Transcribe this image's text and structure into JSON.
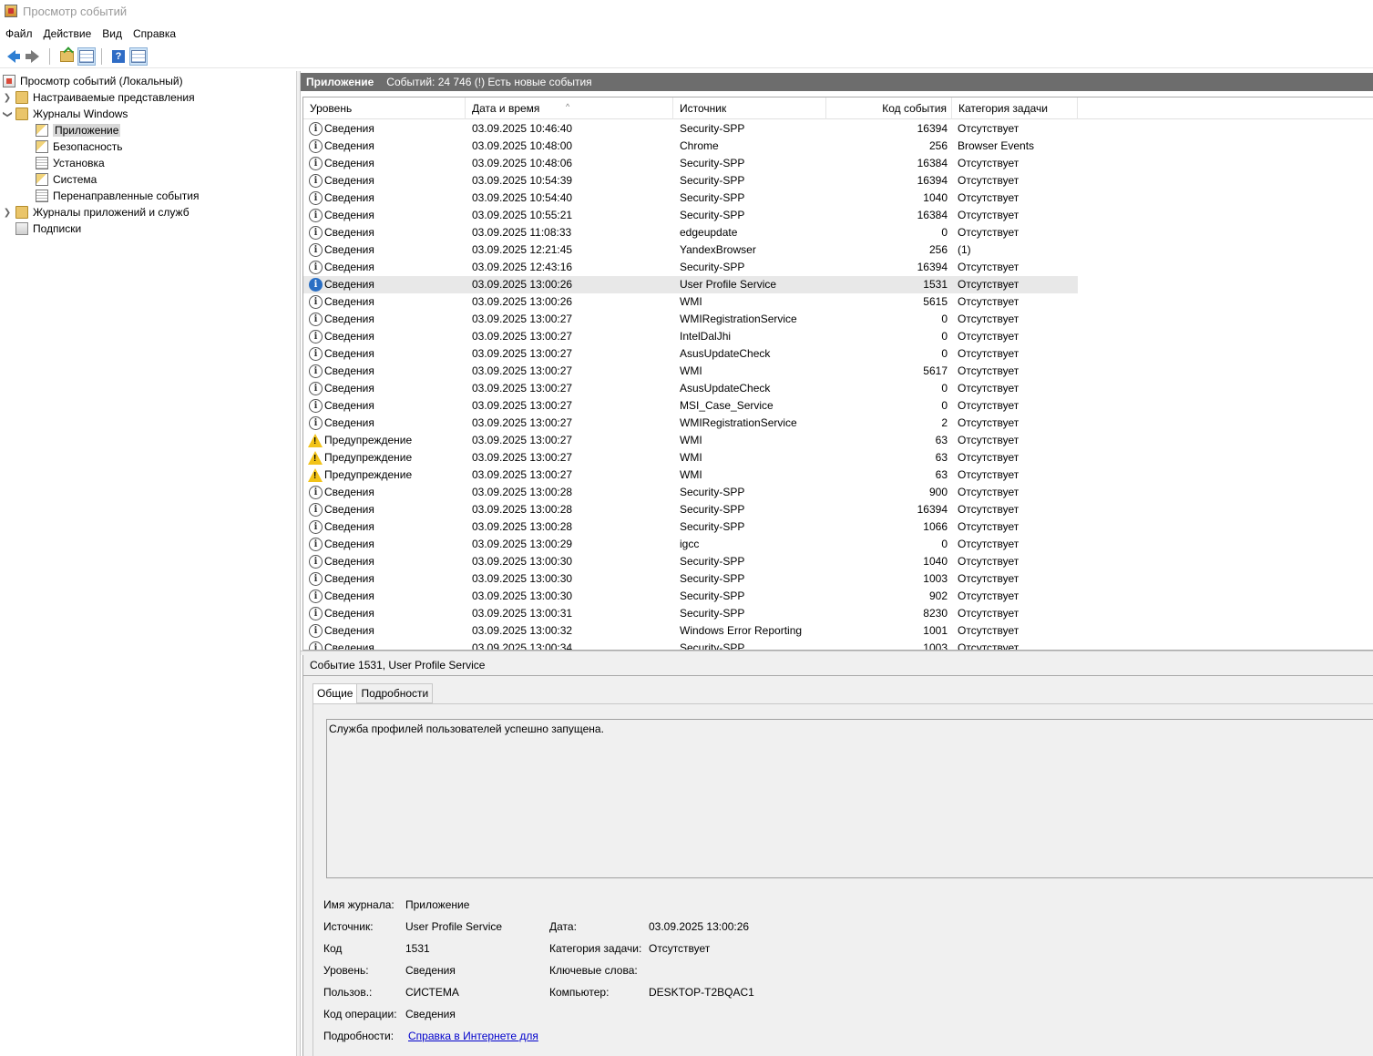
{
  "window": {
    "title": "Просмотр событий"
  },
  "menu": [
    "Файл",
    "Действие",
    "Вид",
    "Справка"
  ],
  "tree": {
    "root": "Просмотр событий (Локальный)",
    "custom_views": "Настраиваемые представления",
    "windows_logs": "Журналы Windows",
    "windows_logs_children": [
      "Приложение",
      "Безопасность",
      "Установка",
      "Система",
      "Перенаправленные события"
    ],
    "app_service_logs": "Журналы приложений и служб",
    "subscriptions": "Подписки"
  },
  "header": {
    "title": "Приложение",
    "info": "Событий: 24 746 (!) Есть новые события"
  },
  "columns": [
    "Уровень",
    "Дата и время",
    "Источник",
    "Код события",
    "Категория задачи"
  ],
  "events": [
    {
      "level": "Сведения",
      "type": "info",
      "datetime": "03.09.2025 10:46:40",
      "source": "Security-SPP",
      "code": "16394",
      "category": "Отсутствует"
    },
    {
      "level": "Сведения",
      "type": "info",
      "datetime": "03.09.2025 10:48:00",
      "source": "Chrome",
      "code": "256",
      "category": "Browser Events"
    },
    {
      "level": "Сведения",
      "type": "info",
      "datetime": "03.09.2025 10:48:06",
      "source": "Security-SPP",
      "code": "16384",
      "category": "Отсутствует"
    },
    {
      "level": "Сведения",
      "type": "info",
      "datetime": "03.09.2025 10:54:39",
      "source": "Security-SPP",
      "code": "16394",
      "category": "Отсутствует"
    },
    {
      "level": "Сведения",
      "type": "info",
      "datetime": "03.09.2025 10:54:40",
      "source": "Security-SPP",
      "code": "1040",
      "category": "Отсутствует"
    },
    {
      "level": "Сведения",
      "type": "info",
      "datetime": "03.09.2025 10:55:21",
      "source": "Security-SPP",
      "code": "16384",
      "category": "Отсутствует"
    },
    {
      "level": "Сведения",
      "type": "info",
      "datetime": "03.09.2025 11:08:33",
      "source": "edgeupdate",
      "code": "0",
      "category": "Отсутствует"
    },
    {
      "level": "Сведения",
      "type": "info",
      "datetime": "03.09.2025 12:21:45",
      "source": "YandexBrowser",
      "code": "256",
      "category": "(1)"
    },
    {
      "level": "Сведения",
      "type": "info",
      "datetime": "03.09.2025 12:43:16",
      "source": "Security-SPP",
      "code": "16394",
      "category": "Отсутствует"
    },
    {
      "level": "Сведения",
      "type": "info",
      "selected": true,
      "datetime": "03.09.2025 13:00:26",
      "source": "User Profile Service",
      "code": "1531",
      "category": "Отсутствует"
    },
    {
      "level": "Сведения",
      "type": "info",
      "datetime": "03.09.2025 13:00:26",
      "source": "WMI",
      "code": "5615",
      "category": "Отсутствует"
    },
    {
      "level": "Сведения",
      "type": "info",
      "datetime": "03.09.2025 13:00:27",
      "source": "WMIRegistrationService",
      "code": "0",
      "category": "Отсутствует"
    },
    {
      "level": "Сведения",
      "type": "info",
      "datetime": "03.09.2025 13:00:27",
      "source": "IntelDalJhi",
      "code": "0",
      "category": "Отсутствует"
    },
    {
      "level": "Сведения",
      "type": "info",
      "datetime": "03.09.2025 13:00:27",
      "source": "AsusUpdateCheck",
      "code": "0",
      "category": "Отсутствует"
    },
    {
      "level": "Сведения",
      "type": "info",
      "datetime": "03.09.2025 13:00:27",
      "source": "WMI",
      "code": "5617",
      "category": "Отсутствует"
    },
    {
      "level": "Сведения",
      "type": "info",
      "datetime": "03.09.2025 13:00:27",
      "source": "AsusUpdateCheck",
      "code": "0",
      "category": "Отсутствует"
    },
    {
      "level": "Сведения",
      "type": "info",
      "datetime": "03.09.2025 13:00:27",
      "source": "MSI_Case_Service",
      "code": "0",
      "category": "Отсутствует"
    },
    {
      "level": "Сведения",
      "type": "info",
      "datetime": "03.09.2025 13:00:27",
      "source": "WMIRegistrationService",
      "code": "2",
      "category": "Отсутствует"
    },
    {
      "level": "Предупреждение",
      "type": "warning",
      "datetime": "03.09.2025 13:00:27",
      "source": "WMI",
      "code": "63",
      "category": "Отсутствует"
    },
    {
      "level": "Предупреждение",
      "type": "warning",
      "datetime": "03.09.2025 13:00:27",
      "source": "WMI",
      "code": "63",
      "category": "Отсутствует"
    },
    {
      "level": "Предупреждение",
      "type": "warning",
      "datetime": "03.09.2025 13:00:27",
      "source": "WMI",
      "code": "63",
      "category": "Отсутствует"
    },
    {
      "level": "Сведения",
      "type": "info",
      "datetime": "03.09.2025 13:00:28",
      "source": "Security-SPP",
      "code": "900",
      "category": "Отсутствует"
    },
    {
      "level": "Сведения",
      "type": "info",
      "datetime": "03.09.2025 13:00:28",
      "source": "Security-SPP",
      "code": "16394",
      "category": "Отсутствует"
    },
    {
      "level": "Сведения",
      "type": "info",
      "datetime": "03.09.2025 13:00:28",
      "source": "Security-SPP",
      "code": "1066",
      "category": "Отсутствует"
    },
    {
      "level": "Сведения",
      "type": "info",
      "datetime": "03.09.2025 13:00:29",
      "source": "igcc",
      "code": "0",
      "category": "Отсутствует"
    },
    {
      "level": "Сведения",
      "type": "info",
      "datetime": "03.09.2025 13:00:30",
      "source": "Security-SPP",
      "code": "1040",
      "category": "Отсутствует"
    },
    {
      "level": "Сведения",
      "type": "info",
      "datetime": "03.09.2025 13:00:30",
      "source": "Security-SPP",
      "code": "1003",
      "category": "Отсутствует"
    },
    {
      "level": "Сведения",
      "type": "info",
      "datetime": "03.09.2025 13:00:30",
      "source": "Security-SPP",
      "code": "902",
      "category": "Отсутствует"
    },
    {
      "level": "Сведения",
      "type": "info",
      "datetime": "03.09.2025 13:00:31",
      "source": "Security-SPP",
      "code": "8230",
      "category": "Отсутствует"
    },
    {
      "level": "Сведения",
      "type": "info",
      "datetime": "03.09.2025 13:00:32",
      "source": "Windows Error Reporting",
      "code": "1001",
      "category": "Отсутствует"
    },
    {
      "level": "Сведения",
      "type": "info",
      "datetime": "03.09.2025 13:00:34",
      "source": "Security-SPP",
      "code": "1003",
      "category": "Отсутствует"
    }
  ],
  "detail": {
    "title": "Событие 1531, User Profile Service",
    "tabs": [
      "Общие",
      "Подробности"
    ],
    "message": "Служба профилей пользователей успешно запущена.",
    "labels": {
      "log_name": "Имя журнала:",
      "source": "Источник:",
      "code": "Код",
      "level": "Уровень:",
      "user": "Пользов.:",
      "opcode": "Код операции:",
      "more": "Подробности:",
      "date": "Дата:",
      "task_category": "Категория задачи:",
      "keywords": "Ключевые слова:",
      "computer": "Компьютер:"
    },
    "values": {
      "log_name": "Приложение",
      "source": "User Profile Service",
      "code": "1531",
      "level": "Сведения",
      "user": "СИСТЕМА",
      "opcode": "Сведения",
      "more_link": "Справка в Интернете для",
      "date": "03.09.2025 13:00:26",
      "task_category": "Отсутствует",
      "keywords": "",
      "computer": "DESKTOP-T2BQAC1"
    }
  },
  "icons": {
    "back": "arrow-left-icon",
    "forward": "arrow-right-icon",
    "folder_up": "folder-up-icon",
    "help": "help-icon",
    "info": "info-icon",
    "warning": "warning-icon"
  },
  "colors": {
    "header_bg": "#6d6d6d",
    "link": "#0000cc",
    "warning": "#f2c318",
    "selected_info": "#2a6fc4"
  }
}
